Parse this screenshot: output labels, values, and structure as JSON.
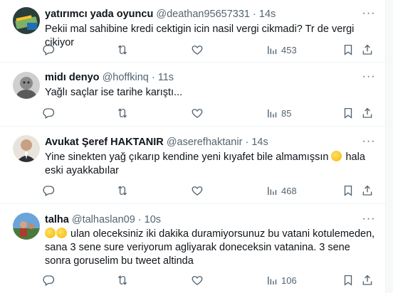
{
  "tweets": [
    {
      "name": "yatırımcı yada oyuncu",
      "handle": "@deathan95657331",
      "time": "14s",
      "text": "Pekii mal sahibine kredi cektigin icin nasil vergi cikmadi? Tr de vergi cikiyor",
      "views": "453"
    },
    {
      "name": "midı denyo",
      "handle": "@hoffkinq",
      "time": "11s",
      "text": "Yağlı saçlar ise tarihe karıştı...",
      "views": "85"
    },
    {
      "name": "Avukat Şeref HAKTANIR",
      "handle": "@aserefhaktanir",
      "time": "14s",
      "text": "Yine sinekten yağ çıkarıp kendine yeni kıyafet bile almamışsın",
      "text_after": " hala eski ayakkabılar",
      "views": "468"
    },
    {
      "name": "talha",
      "handle": "@talhaslan09",
      "time": "10s",
      "text": " ulan oleceksiniz iki dakika duramiyorsunuz bu vatani kotulemeden, sana 3 sene sure veriyorum agliyarak doneceksin vatanina. 3 sene sonra goruselim bu tweet altinda",
      "views": "106"
    }
  ],
  "separator": "·",
  "more_glyph": "···",
  "icons": {
    "reply": "reply-icon",
    "retweet": "retweet-icon",
    "like": "heart-icon",
    "views": "views-chart-icon",
    "bookmark": "bookmark-icon",
    "share": "share-icon",
    "more": "more-icon"
  },
  "colors": {
    "text": "#0f1419",
    "secondary": "#536471",
    "divider": "#eff3f4"
  }
}
